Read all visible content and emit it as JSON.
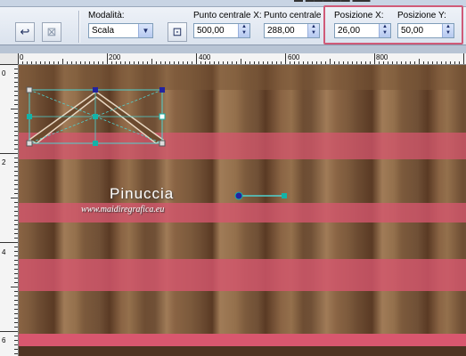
{
  "toolbar": {
    "mode_label": "Modalità:",
    "mode_value": "Scala",
    "center_x_label": "Punto centrale X:",
    "center_x_value": "500,00",
    "center_y_label": "Punto centrale Y:",
    "center_y_value": "288,00",
    "pos_x_label": "Posizione X:",
    "pos_x_value": "26,00",
    "pos_y_label": "Posizione Y:",
    "pos_y_value": "50,00"
  },
  "ruler": {
    "h_ticks": [
      "0",
      "200",
      "400",
      "600",
      "800"
    ],
    "v_ticks": [
      "0",
      "2",
      "4",
      "6"
    ]
  },
  "watermark": {
    "name": "Pinuccia",
    "url": "www.maidiregrafica.eu"
  },
  "colors": {
    "accent_highlight": "#d05a78",
    "pink": "#d9576f",
    "wood_dark": "#5a3a24",
    "wood_light": "#a07b57",
    "handle": "#13b3a8"
  }
}
